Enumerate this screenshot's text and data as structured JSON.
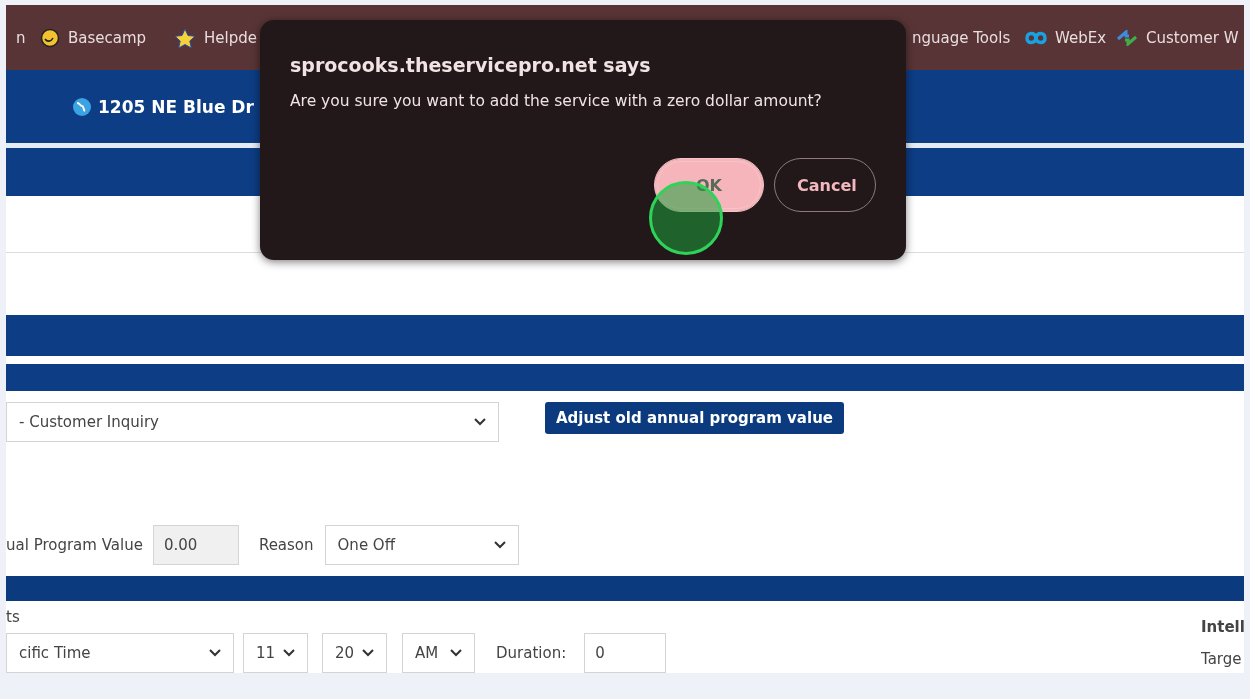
{
  "bookmarks": [
    {
      "label": "n",
      "kind": "none"
    },
    {
      "label": "Basecamp",
      "kind": "smiley"
    },
    {
      "label": "Helpde",
      "kind": "star"
    },
    {
      "label": "nguage Tools",
      "kind": "none"
    },
    {
      "label": "WebEx",
      "kind": "swirl"
    },
    {
      "label": "Customer W",
      "kind": "arrows"
    }
  ],
  "header": {
    "address": "1205 NE Blue Dr"
  },
  "dialog": {
    "title": "sprocooks.theservicepro.net says",
    "message": "Are you sure you want to add the service with a zero dollar amount?",
    "buttons": [
      {
        "label": "OK",
        "selected": true
      },
      {
        "label": "Cancel",
        "selected": false
      }
    ]
  },
  "form": {
    "inquiry_select": "- Customer Inquiry",
    "adjust_button": "Adjust old annual program value",
    "program_value_label": "ual Program Value",
    "program_value": "0.00",
    "reason_label": "Reason",
    "reason_select": "One Off",
    "section_label": "ts",
    "time_select": "cific Time",
    "hour": "11",
    "minute": "20",
    "ampm": "AM",
    "duration_label": "Duration:",
    "duration": "0",
    "side_title": "Intell",
    "side_label": "Targe"
  }
}
